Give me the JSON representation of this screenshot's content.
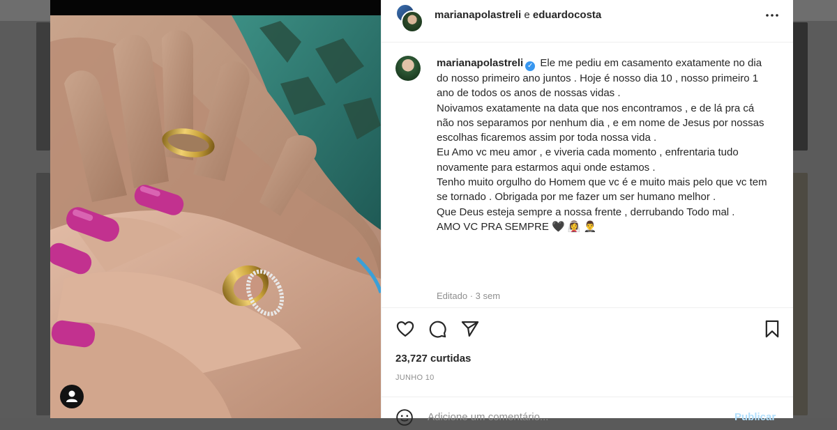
{
  "header": {
    "user1": "marianapolastreli",
    "separator": " e ",
    "user2": "eduardocosta"
  },
  "caption": {
    "username": "marianapolastreli",
    "verified_icon": "verified-badge-icon",
    "text": "Ele me pediu em casamento exatamente no dia do nosso primeiro ano juntos . Hoje é nosso dia 10 , nosso primeiro 1 ano de todos os anos de nossas vidas .\nNoivamos exatamente na data que nos encontramos , e de lá pra cá não nos separamos por nenhum dia , e em nome de Jesus por nossas escolhas ficaremos assim por toda nossa vida .\nEu Amo vc meu amor , e viveria cada momento , enfrentaria tudo novamente para estarmos aqui onde estamos .\nTenho muito orgulho do Homem que vc é e muito mais pelo que vc tem se tornado . Obrigada por me fazer um ser humano melhor .\nQue Deus esteja sempre a nossa frente , derrubando Todo mal .\nAMO VC PRA SEMPRE 🖤 👰‍♀️ 🤵‍♂️",
    "meta": "Editado · 3 sem"
  },
  "actions": {
    "like_icon": "heart-icon",
    "comment_icon": "comment-icon",
    "share_icon": "send-icon",
    "save_icon": "bookmark-icon"
  },
  "likes": "23,727 curtidas",
  "date": "JUNHO 10",
  "comment": {
    "emoji_icon": "smiley-icon",
    "placeholder": "Adicione um comentário...",
    "post_label": "Publicar"
  },
  "photo": {
    "tag_icon": "user-tag-icon"
  },
  "colors": {
    "accent": "#3897f0",
    "post_disabled": "#b2dffc",
    "nail_polish": "#c2318f",
    "ring_gold": "#c9a23a"
  }
}
